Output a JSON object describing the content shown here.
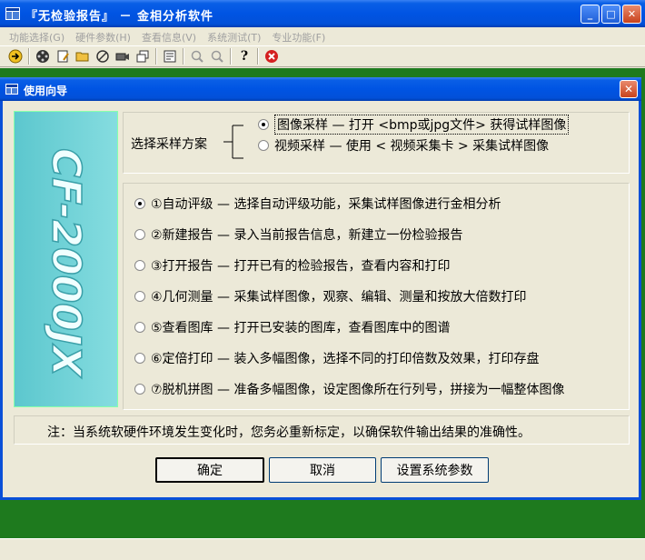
{
  "window": {
    "title": "『无检验报告』 － 金相分析软件",
    "minimize": "_",
    "maximize": "□",
    "close": "✕"
  },
  "menu": [
    "功能选择(G)",
    "硬件参数(H)",
    "查看信息(V)",
    "系统测试(T)",
    "专业功能(F)"
  ],
  "toolbar": {
    "icons": [
      "arrow-right-icon",
      "film-reel-icon",
      "edit-doc-icon",
      "open-folder-icon",
      "no-entry-icon",
      "video-camera-icon",
      "copy-windows-icon",
      "properties-icon",
      "zoom-in-icon",
      "zoom-out-icon",
      "help-icon",
      "close-red-icon"
    ]
  },
  "dialog": {
    "title": "使用向导",
    "close": "✕",
    "logo_text": "CF-2000JX",
    "scheme": {
      "label": "选择采样方案",
      "options": [
        {
          "label": "图像采样 — 打开 <bmp或jpg文件> 获得试样图像",
          "selected": true
        },
        {
          "label": "视频采样 — 使用 < 视频采集卡 > 采集试样图像",
          "selected": false
        }
      ]
    },
    "functions": [
      {
        "label": "①自动评级 — 选择自动评级功能，采集试样图像进行金相分析",
        "selected": true
      },
      {
        "label": "②新建报告 — 录入当前报告信息，新建立一份检验报告",
        "selected": false
      },
      {
        "label": "③打开报告 — 打开已有的检验报告，查看内容和打印",
        "selected": false
      },
      {
        "label": "④几何测量 — 采集试样图像，观察、编辑、测量和按放大倍数打印",
        "selected": false
      },
      {
        "label": "⑤查看图库 — 打开已安装的图库，查看图库中的图谱",
        "selected": false
      },
      {
        "label": "⑥定倍打印 — 装入多幅图像，选择不同的打印倍数及效果，打印存盘",
        "selected": false
      },
      {
        "label": "⑦脱机拼图 — 准备多幅图像，设定图像所在行列号，拼接为一幅整体图像",
        "selected": false
      }
    ],
    "note": "注：当系统软硬件环境发生变化时，您务必重新标定，以确保软件输出结果的准确性。",
    "buttons": {
      "ok": "确定",
      "cancel": "取消",
      "settings": "设置系统参数"
    }
  }
}
